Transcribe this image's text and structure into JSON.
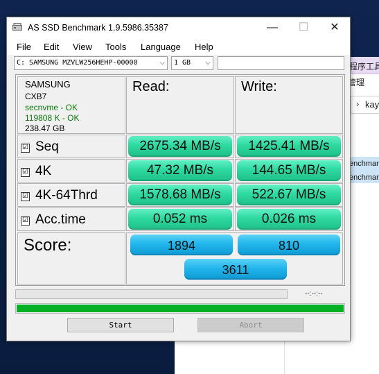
{
  "background_window": {
    "menu_fragment": "程序工具",
    "sub_fragment": "管理",
    "address_fragment": "kay",
    "list_items": [
      "enchmar",
      "enchmar"
    ]
  },
  "window": {
    "title": "AS SSD Benchmark 1.9.5986.35387",
    "minimize": "—",
    "maximize": "☐",
    "close": "✕"
  },
  "menu": [
    "File",
    "Edit",
    "View",
    "Tools",
    "Language",
    "Help"
  ],
  "drive_select": {
    "value": "C: SAMSUNG MZVLW256HEHP-00000",
    "arrow": "⌵"
  },
  "size_select": {
    "value": "1 GB",
    "arrow": "⌵"
  },
  "drive_info": {
    "vendor": "SAMSUNG",
    "firmware": "CXB7",
    "driver": "secnvme - OK",
    "alignment": "119808 K - OK",
    "capacity": "238.47 GB"
  },
  "headers": {
    "read": "Read:",
    "write": "Write:"
  },
  "checkmark": "☑",
  "tests": [
    {
      "label": "Seq",
      "checked": true,
      "read": "2675.34 MB/s",
      "write": "1425.41 MB/s"
    },
    {
      "label": "4K",
      "checked": true,
      "read": "47.32 MB/s",
      "write": "144.65 MB/s"
    },
    {
      "label": "4K-64Thrd",
      "checked": true,
      "read": "1578.68 MB/s",
      "write": "522.67 MB/s"
    },
    {
      "label": "Acc.time",
      "checked": true,
      "read": "0.052 ms",
      "write": "0.026 ms"
    }
  ],
  "score": {
    "label": "Score:",
    "read": "1894",
    "write": "810",
    "total": "3611"
  },
  "timer": "--:--:--",
  "progress_fraction": 1.0,
  "buttons": {
    "start": "Start",
    "abort": "Abort"
  },
  "colors": {
    "result_green": "#2ed9a0",
    "score_blue": "#21b6ec",
    "progress_green": "#06b025"
  }
}
